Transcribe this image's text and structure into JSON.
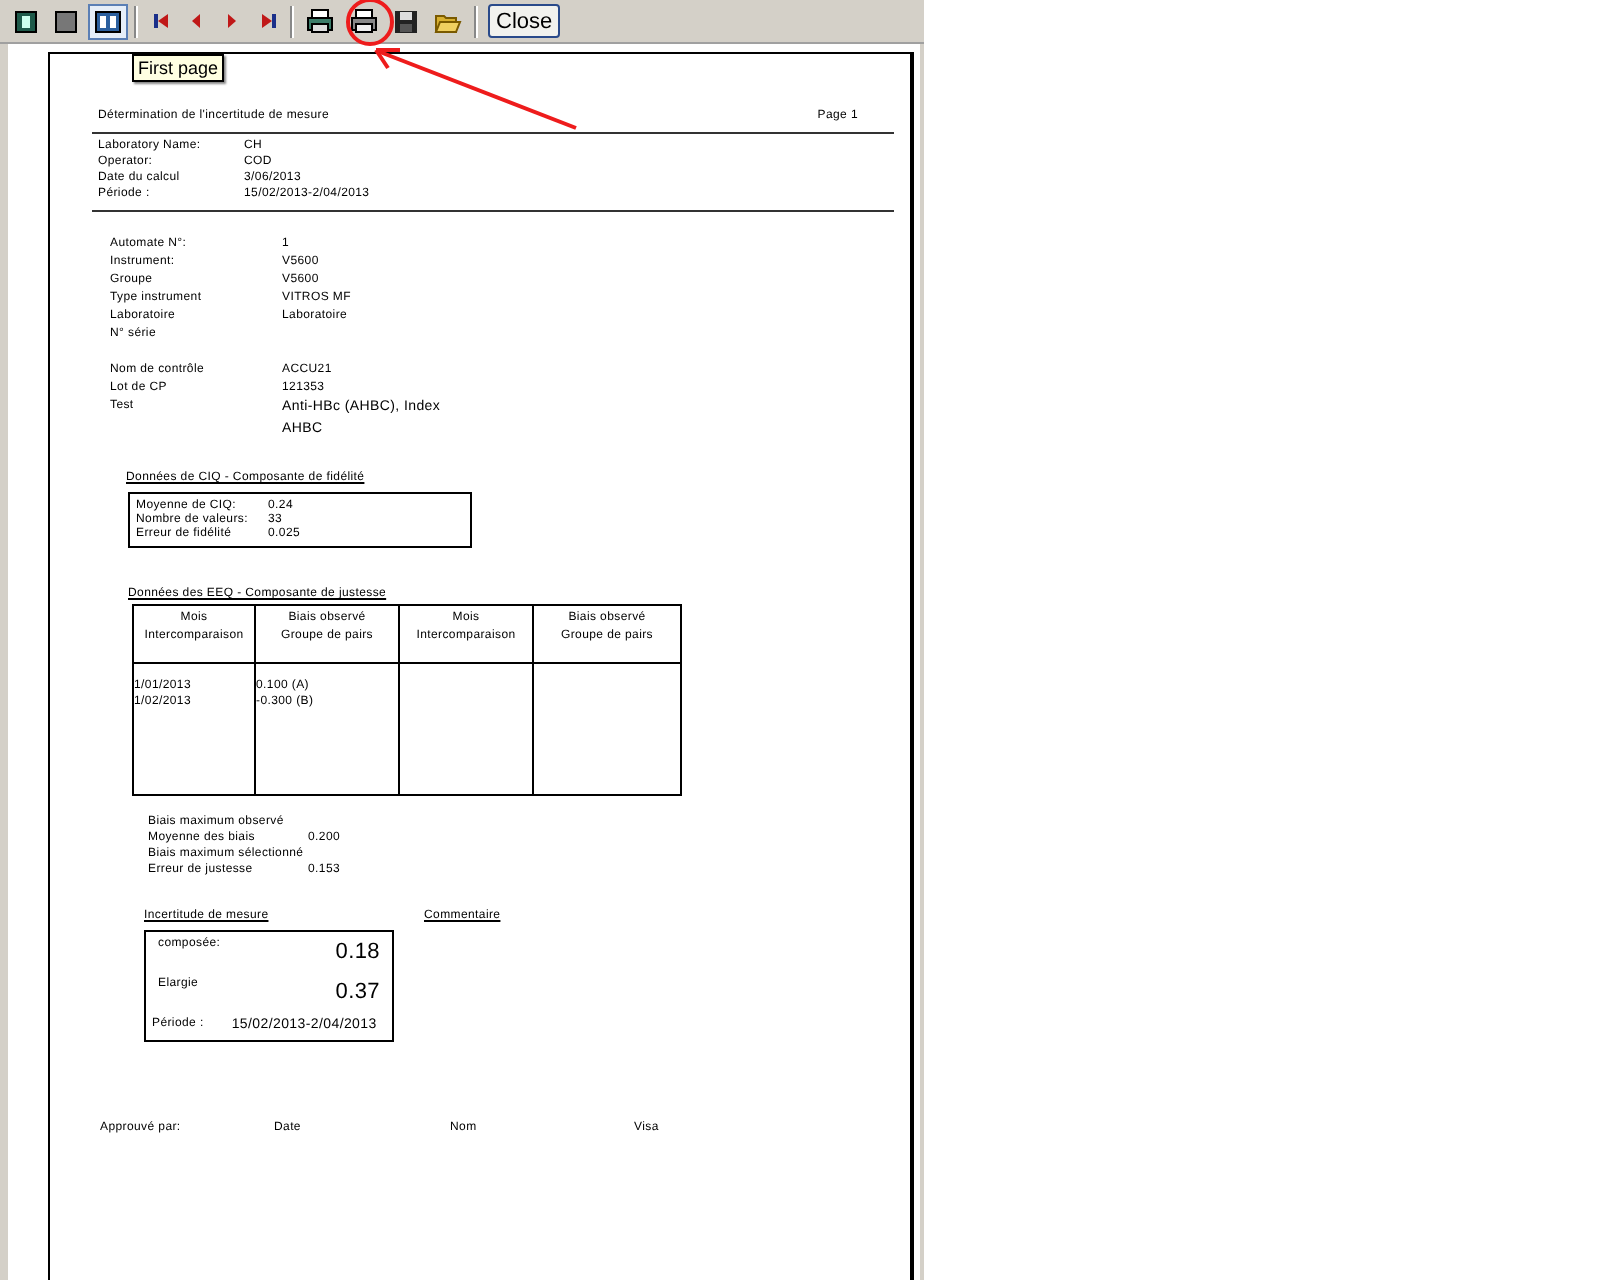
{
  "toolbar": {
    "view_buttons": [
      {
        "kind": "single",
        "selected": false
      },
      {
        "kind": "width",
        "selected": false
      },
      {
        "kind": "two",
        "selected": true
      }
    ],
    "nav_buttons": [
      {
        "kind": "first"
      },
      {
        "kind": "prev"
      },
      {
        "kind": "next"
      },
      {
        "kind": "last"
      }
    ],
    "close_button": "Close"
  },
  "tooltip": "First page",
  "report": {
    "title": "Détermination de l'incertitude de mesure",
    "page_label": "Page 1",
    "header_fields": [
      {
        "label": "Laboratory Name:",
        "value": "CH"
      },
      {
        "label": "Operator:",
        "value": "COD"
      },
      {
        "label": "Date du calcul",
        "value": "3/06/2013"
      },
      {
        "label": "Période :",
        "value": "15/02/2013-2/04/2013"
      }
    ],
    "instrument_fields": [
      {
        "label": "Automate N°:",
        "value": "1"
      },
      {
        "label": "Instrument:",
        "value": "V5600"
      },
      {
        "label": "Groupe",
        "value": "V5600"
      },
      {
        "label": "Type instrument",
        "value": "VITROS MF"
      },
      {
        "label": "Laboratoire",
        "value": "Laboratoire"
      },
      {
        "label": "N° série"
      }
    ],
    "control_fields": [
      {
        "label": "Nom de contrôle",
        "values": [
          "ACCU21"
        ]
      },
      {
        "label": "Lot de CP",
        "values": [
          "121353"
        ]
      },
      {
        "label": "Test",
        "values": [
          "Anti-HBc (AHBC), Index",
          "AHBC"
        ]
      }
    ],
    "ciq": {
      "title": "Données de CIQ - Composante de fidélité",
      "rows": [
        {
          "label": "Moyenne de CIQ:",
          "value": "0.24"
        },
        {
          "label": "Nombre de valeurs:",
          "value": "33"
        },
        {
          "label": "Erreur de fidélité",
          "value": "0.025"
        }
      ]
    },
    "eeq": {
      "title": "Données des EEQ - Composante de justesse",
      "columns": [
        "Mois\nIntercomparaison",
        "Biais observé\nGroupe de pairs",
        "Mois\nIntercomparaison",
        "Biais observé\nGroupe de pairs"
      ],
      "rows": [
        [
          "1/01/2013",
          "0.100  (A)"
        ],
        [
          "1/02/2013",
          "-0.300  (B)"
        ]
      ]
    },
    "bias_fields": [
      {
        "label": "Biais maximum observé"
      },
      {
        "label": "Moyenne des biais",
        "value": "0.200"
      },
      {
        "label": "Biais maximum sélectionné"
      },
      {
        "label": "Erreur de justesse",
        "value": "0.153"
      }
    ],
    "uncertainty": {
      "title": "Incertitude de mesure",
      "rows": [
        {
          "label": "composée:",
          "value": "0.18"
        },
        {
          "label": "Elargie",
          "value": "0.37"
        }
      ],
      "period_label": "Période :",
      "period_value": "15/02/2013-2/04/2013"
    },
    "comment_title": "Commentaire",
    "footer": [
      "Approuvé par:",
      "Date",
      "Nom",
      "Visa"
    ]
  }
}
